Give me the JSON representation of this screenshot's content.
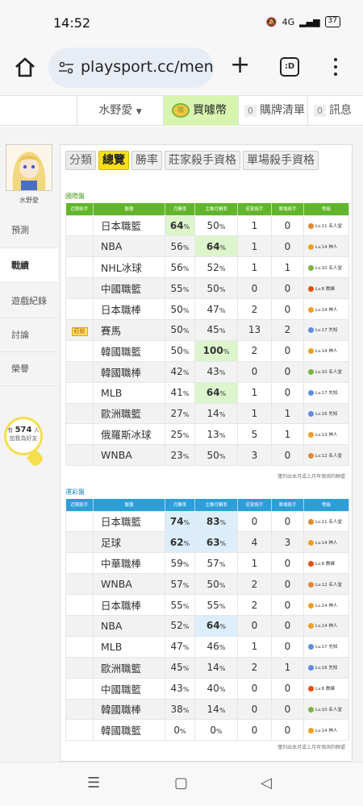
{
  "status_bar": {
    "time": "14:52",
    "battery": "37",
    "signal_text": "4G"
  },
  "browser": {
    "url": "playsport.cc/men",
    "tabs_label": ":D"
  },
  "topnav": {
    "username": "水野愛",
    "coin_label": "買噱幣",
    "purchase_count": "0",
    "purchase_label": "購牌清單",
    "message_count": "0",
    "message_label": "訊息"
  },
  "sidebar": {
    "name": "水野愛",
    "items": [
      {
        "label": "預測"
      },
      {
        "label": "戰績"
      },
      {
        "label": "遊戲紀錄"
      },
      {
        "label": "討論"
      },
      {
        "label": "榮譽"
      }
    ],
    "counter_prefix": "有",
    "counter_value": "574",
    "counter_suffix": "人",
    "counter_line2": "加我為好友"
  },
  "filters": {
    "label": "分類",
    "items": [
      "總覽",
      "勝率",
      "莊家殺手資格",
      "單場殺手資格"
    ]
  },
  "colors": {
    "green_header": "#62b52a",
    "blue_header": "#2c9ed8",
    "highlight_green": "#ddf5cc",
    "highlight_blue": "#dceefb",
    "active_chip": "#f9e01b"
  },
  "table_headers": [
    "近期殺手",
    "聯盟",
    "月勝率",
    "主推月勝率",
    "莊家殺手",
    "單場殺手",
    "等級"
  ],
  "section1": {
    "title": "國際盤",
    "note": "僅列出本月或上月有預測的聯盟",
    "rows": [
      {
        "killer": "",
        "league": "日本職籃",
        "win": "64",
        "main": "50",
        "bk": "1",
        "sg": "0",
        "lv": "Lv.11 名人堂",
        "lvcolor": "#e08a2c",
        "hl": "win"
      },
      {
        "killer": "",
        "league": "NBA",
        "win": "56",
        "main": "64",
        "bk": "1",
        "sg": "0",
        "lv": "Lv.14 神人",
        "lvcolor": "#f0a020",
        "hl": "main"
      },
      {
        "killer": "",
        "league": "NHL冰球",
        "win": "56",
        "main": "52",
        "bk": "1",
        "sg": "1",
        "lv": "Lv.10 名人堂",
        "lvcolor": "#7cb342",
        "hl": ""
      },
      {
        "killer": "",
        "league": "中國職籃",
        "win": "55",
        "main": "50",
        "bk": "0",
        "sg": "0",
        "lv": "Lv.8 教練",
        "lvcolor": "#e65100",
        "hl": ""
      },
      {
        "killer": "",
        "league": "日本職棒",
        "win": "50",
        "main": "47",
        "bk": "2",
        "sg": "0",
        "lv": "Lv.14 神人",
        "lvcolor": "#f0a020",
        "hl": ""
      },
      {
        "killer": "莊殺",
        "league": "賽馬",
        "win": "50",
        "main": "45",
        "bk": "13",
        "sg": "2",
        "lv": "Lv.17 先知",
        "lvcolor": "#5c8ee0",
        "hl": ""
      },
      {
        "killer": "",
        "league": "韓國職籃",
        "win": "50",
        "main": "100",
        "bk": "2",
        "sg": "0",
        "lv": "Lv.14 神人",
        "lvcolor": "#f0a020",
        "hl": "main"
      },
      {
        "killer": "",
        "league": "韓國職棒",
        "win": "42",
        "main": "43",
        "bk": "0",
        "sg": "0",
        "lv": "Lv.10 名人堂",
        "lvcolor": "#7cb342",
        "hl": ""
      },
      {
        "killer": "",
        "league": "MLB",
        "win": "41",
        "main": "64",
        "bk": "1",
        "sg": "0",
        "lv": "Lv.17 先知",
        "lvcolor": "#5c8ee0",
        "hl": "main"
      },
      {
        "killer": "",
        "league": "歐洲職籃",
        "win": "27",
        "main": "14",
        "bk": "1",
        "sg": "1",
        "lv": "Lv.16 先知",
        "lvcolor": "#5c8ee0",
        "hl": ""
      },
      {
        "killer": "",
        "league": "俄羅斯冰球",
        "win": "25",
        "main": "13",
        "bk": "5",
        "sg": "1",
        "lv": "Lv.13 神人",
        "lvcolor": "#f0a020",
        "hl": ""
      },
      {
        "killer": "",
        "league": "WNBA",
        "win": "23",
        "main": "50",
        "bk": "3",
        "sg": "0",
        "lv": "Lv.12 名人堂",
        "lvcolor": "#e08a2c",
        "hl": ""
      }
    ]
  },
  "section2": {
    "title": "運彩盤",
    "note": "僅列出本月或上月有預測的聯盟",
    "rows": [
      {
        "killer": "",
        "league": "日本職籃",
        "win": "74",
        "main": "83",
        "bk": "0",
        "sg": "0",
        "lv": "Lv.11 名人堂",
        "lvcolor": "#e08a2c",
        "hl": "both"
      },
      {
        "killer": "",
        "league": "足球",
        "win": "62",
        "main": "63",
        "bk": "4",
        "sg": "3",
        "lv": "Lv.14 神人",
        "lvcolor": "#f0a020",
        "hl": "both"
      },
      {
        "killer": "",
        "league": "中華職棒",
        "win": "59",
        "main": "57",
        "bk": "1",
        "sg": "0",
        "lv": "Lv.8 教練",
        "lvcolor": "#e65100",
        "hl": ""
      },
      {
        "killer": "",
        "league": "WNBA",
        "win": "57",
        "main": "50",
        "bk": "2",
        "sg": "0",
        "lv": "Lv.12 名人堂",
        "lvcolor": "#e08a2c",
        "hl": ""
      },
      {
        "killer": "",
        "league": "日本職棒",
        "win": "55",
        "main": "55",
        "bk": "2",
        "sg": "0",
        "lv": "Lv.14 神人",
        "lvcolor": "#f0a020",
        "hl": ""
      },
      {
        "killer": "",
        "league": "NBA",
        "win": "52",
        "main": "64",
        "bk": "0",
        "sg": "0",
        "lv": "Lv.14 神人",
        "lvcolor": "#f0a020",
        "hl": "main"
      },
      {
        "killer": "",
        "league": "MLB",
        "win": "47",
        "main": "46",
        "bk": "1",
        "sg": "0",
        "lv": "Lv.17 先知",
        "lvcolor": "#5c8ee0",
        "hl": ""
      },
      {
        "killer": "",
        "league": "歐洲職籃",
        "win": "45",
        "main": "14",
        "bk": "2",
        "sg": "1",
        "lv": "Lv.16 先知",
        "lvcolor": "#5c8ee0",
        "hl": ""
      },
      {
        "killer": "",
        "league": "中國職籃",
        "win": "43",
        "main": "40",
        "bk": "0",
        "sg": "0",
        "lv": "Lv.8 教練",
        "lvcolor": "#e65100",
        "hl": ""
      },
      {
        "killer": "",
        "league": "韓國職棒",
        "win": "38",
        "main": "14",
        "bk": "0",
        "sg": "0",
        "lv": "Lv.10 名人堂",
        "lvcolor": "#7cb342",
        "hl": ""
      },
      {
        "killer": "",
        "league": "韓國職籃",
        "win": "0",
        "main": "0",
        "bk": "0",
        "sg": "0",
        "lv": "Lv.14 神人",
        "lvcolor": "#f0a020",
        "hl": ""
      }
    ]
  },
  "percent_sign": "%"
}
